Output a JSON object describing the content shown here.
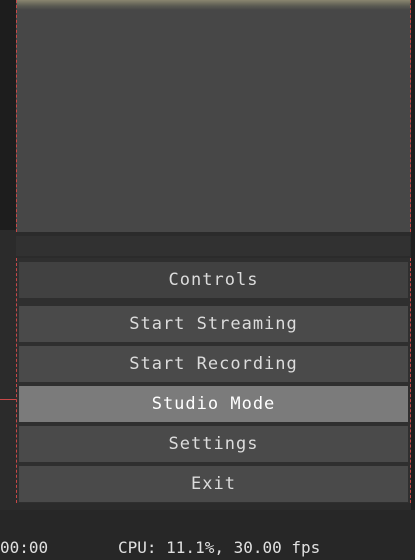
{
  "panel": {
    "header": "Controls",
    "buttons": [
      {
        "label": "Start Streaming"
      },
      {
        "label": "Start Recording"
      },
      {
        "label": "Studio Mode"
      },
      {
        "label": "Settings"
      },
      {
        "label": "Exit"
      }
    ]
  },
  "status": {
    "time": "00:00",
    "cpu": "CPU: 11.1%, 30.00 fps"
  },
  "colors": {
    "background": "#2b2b2b",
    "preview": "#474747",
    "button": "#4a4a4a",
    "button_active": "#7b7b7b",
    "guide": "#c84848"
  }
}
